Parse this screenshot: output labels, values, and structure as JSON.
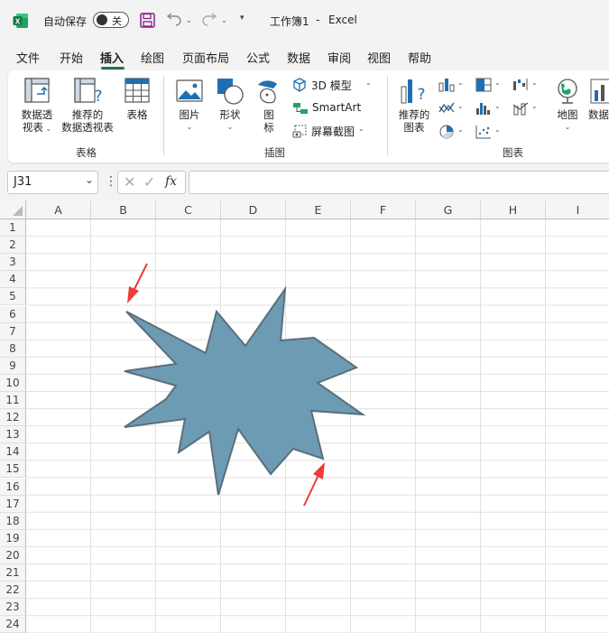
{
  "titlebar": {
    "autosave_label": "自动保存",
    "autosave_state": "关",
    "doc_title": "工作簿1",
    "separator": "-",
    "app_name": "Excel"
  },
  "tabs": [
    "文件",
    "开始",
    "插入",
    "绘图",
    "页面布局",
    "公式",
    "数据",
    "审阅",
    "视图",
    "帮助"
  ],
  "active_tab": "插入",
  "ribbon": {
    "tables_group": {
      "label": "表格",
      "pivot_line1": "数据透",
      "pivot_line2": "视表",
      "recommended_pivot_line1": "推荐的",
      "recommended_pivot_line2": "数据透视表",
      "table": "表格"
    },
    "illustrations_group": {
      "label": "插图",
      "pictures": "图片",
      "shapes": "形状",
      "icons_line1": "图",
      "icons_line2": "标",
      "model3d": "3D 模型",
      "smartart": "SmartArt",
      "screenshot": "屏幕截图"
    },
    "charts_group": {
      "label": "图表",
      "recommended_charts_line1": "推荐的",
      "recommended_charts_line2": "图表",
      "maps": "地图",
      "pivot_chart_partial": "数据"
    }
  },
  "formula_bar": {
    "name_box": "J31",
    "formula": ""
  },
  "columns": [
    "A",
    "B",
    "C",
    "D",
    "E",
    "F",
    "G",
    "H",
    "I"
  ],
  "rows": [
    "1",
    "2",
    "3",
    "4",
    "5",
    "6",
    "7",
    "8",
    "9",
    "10",
    "11",
    "12",
    "13",
    "14",
    "15",
    "16",
    "17",
    "18",
    "19",
    "20",
    "21",
    "22",
    "23",
    "24"
  ],
  "colors": {
    "accent": "#217346",
    "shape_fill": "#6e9bb4",
    "shape_stroke": "#5a6f7c",
    "arrow": "#ee3b3b"
  }
}
